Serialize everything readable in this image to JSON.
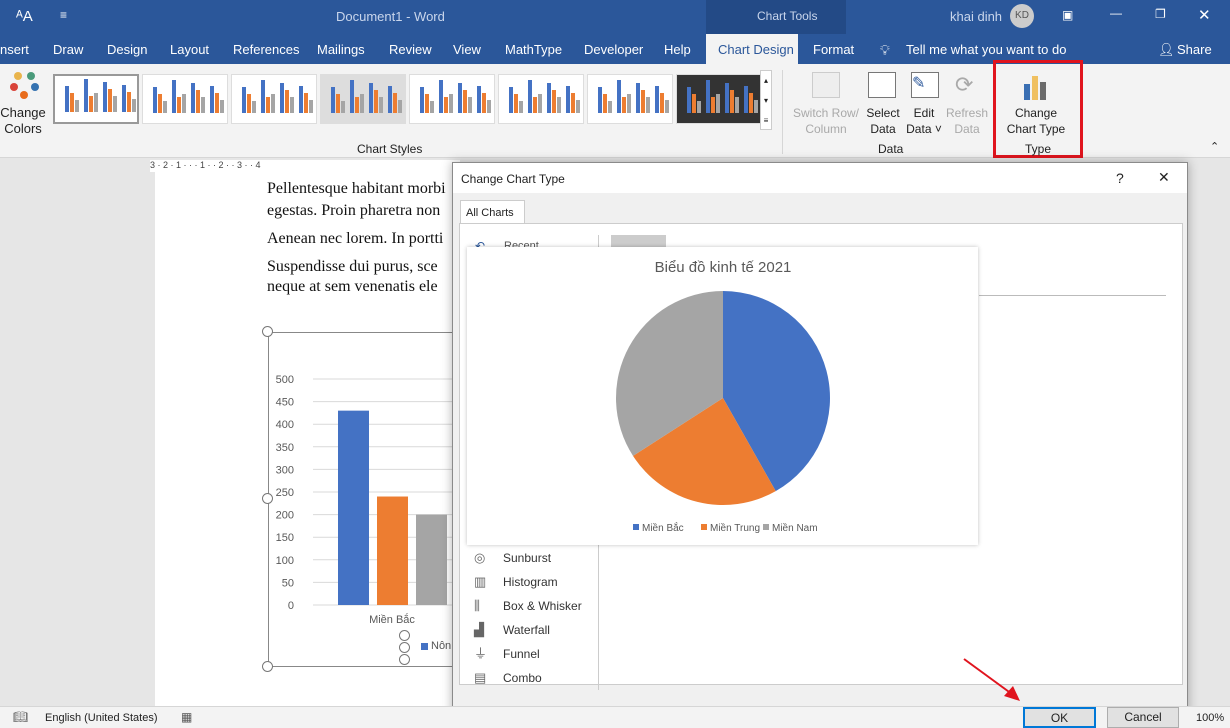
{
  "titlebar": {
    "doc_title": "Document1  -  Word",
    "context": "Chart Tools",
    "user": "khai dinh",
    "avatar": "KD"
  },
  "tabs": [
    "nsert",
    "Draw",
    "Design",
    "Layout",
    "References",
    "Mailings",
    "Review",
    "View",
    "MathType",
    "Developer",
    "Help",
    "Chart Design",
    "Format"
  ],
  "tell_me": "Tell me what you want to do",
  "share": "Share",
  "ribbon": {
    "change_colors": [
      "Change",
      "Colors"
    ],
    "chart_styles_label": "Chart Styles",
    "switch_row": [
      "Switch Row/",
      "Column"
    ],
    "select_data": [
      "Select",
      "Data"
    ],
    "edit_data": [
      "Edit",
      "Data"
    ],
    "refresh_data": [
      "Refresh",
      "Data"
    ],
    "data_group": "Data",
    "change_chart_type": [
      "Change",
      "Chart Type"
    ],
    "type_group": "Type"
  },
  "ruler": "3 · 2 · 1 · · · 1 · · 2 · · 3 · · 4",
  "document": {
    "lines": [
      "Pellentesque habitant morbi",
      "egestas. Proin pharetra non",
      "Aenean nec lorem. In portti",
      "Suspendisse dui purus, sce",
      "neque at sem venenatis ele"
    ]
  },
  "chart_data": [
    {
      "type": "bar",
      "categories": [
        "Miền Bắc"
      ],
      "series": [
        {
          "values": [
            430
          ]
        },
        {
          "values": [
            240
          ]
        },
        {
          "values": [
            200
          ]
        }
      ],
      "yticks": [
        "0",
        "50",
        "100",
        "150",
        "200",
        "250",
        "300",
        "350",
        "400",
        "450",
        "500"
      ],
      "ylim": [
        0,
        500
      ],
      "legend_partial": "Nôn",
      "colors": [
        "#4472c4",
        "#ed7d31",
        "#a5a5a5"
      ]
    },
    {
      "type": "pie",
      "title": "Biểu đồ kinh tế 2021",
      "categories": [
        "Miền Bắc",
        "Miền Trung",
        "Miền Nam"
      ],
      "values": [
        41.8,
        24.1,
        34.1
      ],
      "colors": [
        "#4472c4",
        "#ed7d31",
        "#a5a5a5"
      ],
      "legend": "bottom"
    }
  ],
  "dialog": {
    "title": "Change Chart Type",
    "help": "?",
    "close": "✕",
    "tab": "All Charts",
    "recent": "Recent",
    "types": [
      "Sunburst",
      "Histogram",
      "Box & Whisker",
      "Waterfall",
      "Funnel",
      "Combo"
    ],
    "ok": "OK",
    "cancel": "Cancel"
  },
  "status": {
    "language": "English (United States)",
    "zoom": "100%"
  }
}
